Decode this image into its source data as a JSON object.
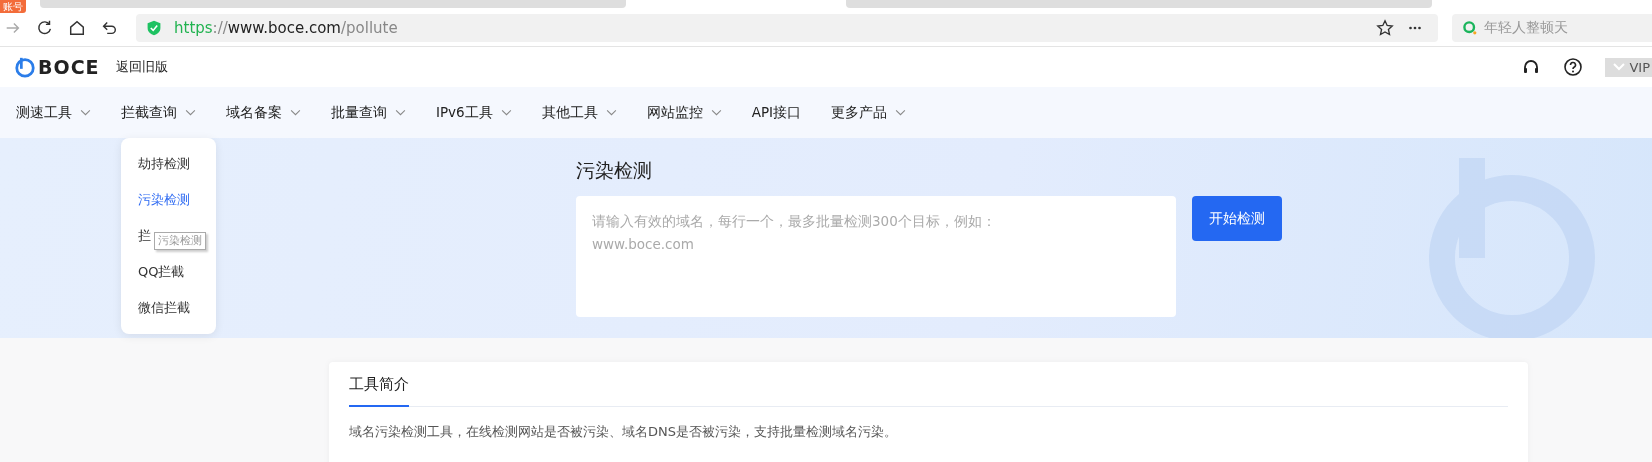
{
  "browser": {
    "badge": "账号",
    "url": {
      "scheme": "https",
      "separator": "://",
      "host": "www.boce.com",
      "path": "/pollute"
    },
    "search": {
      "placeholder": "年轻人整顿天"
    }
  },
  "header": {
    "logo": "BOCE",
    "back_link": "返回旧版",
    "vip": "VIP"
  },
  "nav": [
    {
      "label": "测速工具",
      "dropdown": true
    },
    {
      "label": "拦截查询",
      "dropdown": true,
      "menu": [
        {
          "label": "劫持检测",
          "selected": false
        },
        {
          "label": "污染检测",
          "selected": true
        },
        {
          "label": "拦",
          "selected": false
        },
        {
          "label": "QQ拦截",
          "selected": false
        },
        {
          "label": "微信拦截",
          "selected": false
        }
      ]
    },
    {
      "label": "域名备案",
      "dropdown": true
    },
    {
      "label": "批量查询",
      "dropdown": true
    },
    {
      "label": "IPv6工具",
      "dropdown": true
    },
    {
      "label": "其他工具",
      "dropdown": true
    },
    {
      "label": "网站监控",
      "dropdown": true
    },
    {
      "label": "API接口",
      "dropdown": false
    },
    {
      "label": "更多产品",
      "dropdown": true
    }
  ],
  "tooltip": "污染检测",
  "hero": {
    "title": "污染检测",
    "placeholder": "请输入有效的域名，每行一个，最多批量检测300个目标，例如：\nwww.boce.com",
    "button": "开始检测"
  },
  "intro": {
    "tab": "工具简介",
    "text": "域名污染检测工具，在线检测网站是否被污染、域名DNS是否被污染，支持批量检测域名污染。"
  }
}
